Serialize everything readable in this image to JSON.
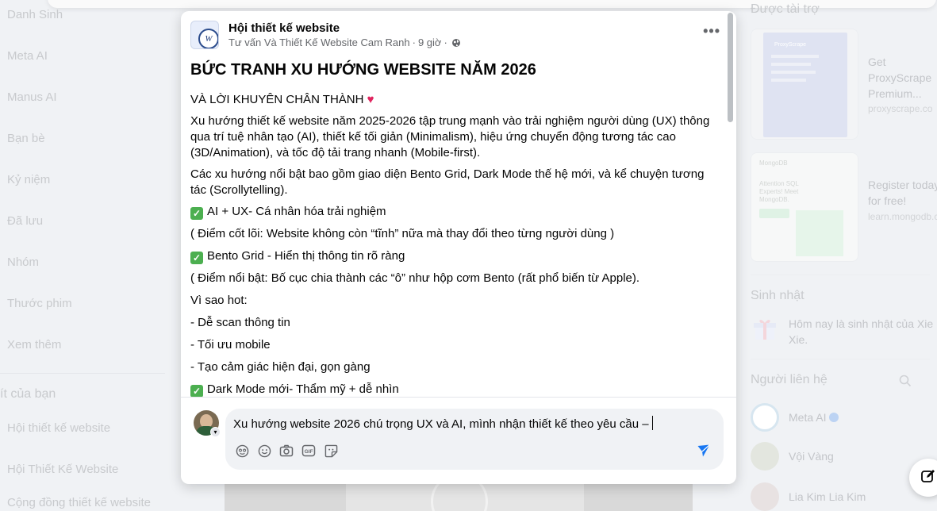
{
  "left_sidebar": {
    "items": [
      "Danh Sinh",
      "Meta AI",
      "Manus AI",
      "Bạn bè",
      "Kỷ niệm",
      "Đã lưu",
      "Nhóm",
      "Thước phim",
      "Xem thêm"
    ],
    "section_title": "ít của bạn",
    "shortcuts": [
      "Hội thiết kế website",
      "Hội Thiết Kế Website",
      "Cộng đồng thiết kế website"
    ]
  },
  "right_sidebar": {
    "sponsored_title": "Được tài trợ",
    "ads": [
      {
        "title": "Get ProxyScrape Premium...",
        "url": "proxyscrape.co",
        "image_brand": "ProxyScrape"
      },
      {
        "title": "Register today for free!",
        "url": "learn.mongodb.com",
        "image_brand": "MongoDB",
        "image_caption": "Attention SQL Experts! Meet MongoDB."
      }
    ],
    "birthday_title": "Sinh nhật",
    "birthday_text": "Hôm nay là sinh nhật của Xie Xie.",
    "contacts_title": "Người liên hệ",
    "contacts": [
      "Meta AI",
      "Vội Vàng",
      "Lia Kim Lia Kim"
    ]
  },
  "post": {
    "page_name": "Hội thiết kế website",
    "author": "Tư vấn Và Thiết Kế Website Cam Ranh",
    "time": "9 giờ",
    "separator": "·",
    "title": "BỨC TRANH XU HƯỚNG WEBSITE NĂM 2026",
    "subtitle": "VÀ LỜI KHUYÊN CHÂN THÀNH",
    "paragraphs": [
      "Xu hướng thiết kế website năm 2025-2026 tập trung mạnh vào trải nghiệm người dùng (UX) thông qua trí tuệ nhân tạo (AI), thiết kế tối giản (Minimalism), hiệu ứng chuyển động tương tác cao (3D/Animation), và tốc độ tải trang nhanh (Mobile-first).",
      "Các xu hướng nổi bật bao gồm giao diện Bento Grid, Dark Mode thế hệ mới, và kể chuyện tương tác (Scrollytelling)."
    ],
    "checks": [
      "AI + UX- Cá nhân hóa trải nghiệm",
      "Bento Grid - Hiển thị thông tin rõ ràng",
      "Dark Mode mới- Thẩm mỹ + dễ nhìn"
    ],
    "notes": [
      "( Điểm cốt lõi: Website không còn “tĩnh” nữa mà thay đổi theo từng người dùng )",
      "( Điểm nổi bật: Bố cục chia thành các “ô” như hộp cơm Bento (rất phổ biến từ Apple)."
    ],
    "why_title": "Vì sao hot:",
    "why_items": [
      "- Dễ scan thông tin",
      "- Tối ưu mobile",
      "- Tạo cảm giác hiện đại, gọn gàng"
    ]
  },
  "comment": {
    "value": "Xu hướng website 2026 chú trọng UX và AI, mình nhận thiết kế theo yêu cầu –",
    "tools": [
      "avatar-sticker-icon",
      "emoji-icon",
      "camera-icon",
      "gif-icon",
      "sticker-icon"
    ]
  },
  "colors": {
    "accent": "#1877f2",
    "check": "#4caf50",
    "heart": "#e0245e"
  }
}
